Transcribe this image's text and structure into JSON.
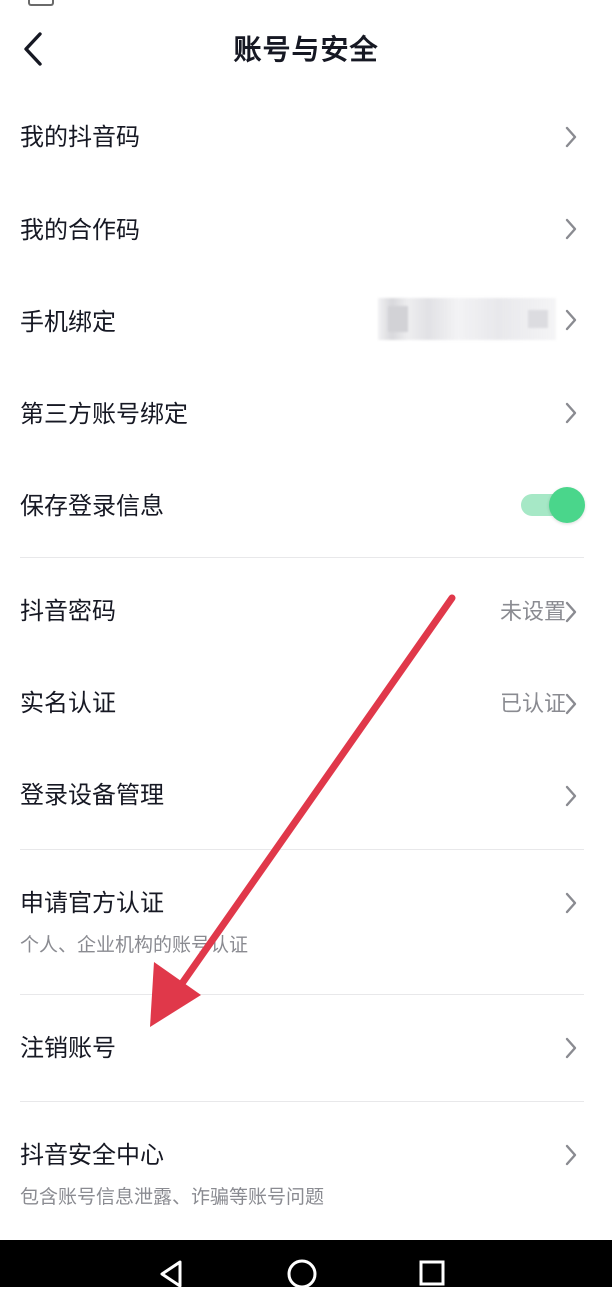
{
  "header": {
    "title": "账号与安全",
    "back_icon": "chevron-left-icon"
  },
  "rows": [
    {
      "label": "我的抖音码"
    },
    {
      "label": "我的合作码"
    },
    {
      "label": "手机绑定"
    },
    {
      "label": "第三方账号绑定"
    },
    {
      "label": "保存登录信息",
      "toggle_on": true
    },
    {
      "label": "抖音密码",
      "value": "未设置"
    },
    {
      "label": "实名认证",
      "value": "已认证"
    },
    {
      "label": "登录设备管理"
    },
    {
      "label": "申请官方认证",
      "sub": "个人、企业机构的账号认证"
    },
    {
      "label": "注销账号"
    },
    {
      "label": "抖音安全中心",
      "sub": "包含账号信息泄露、诈骗等账号问题"
    }
  ],
  "colors": {
    "toggle_on": "#4ad68b",
    "annotation_arrow": "#e0384a",
    "secondary_text": "#8a8b91"
  },
  "nav": {
    "icons": [
      "back-triangle-icon",
      "home-circle-icon",
      "recents-square-icon"
    ]
  }
}
